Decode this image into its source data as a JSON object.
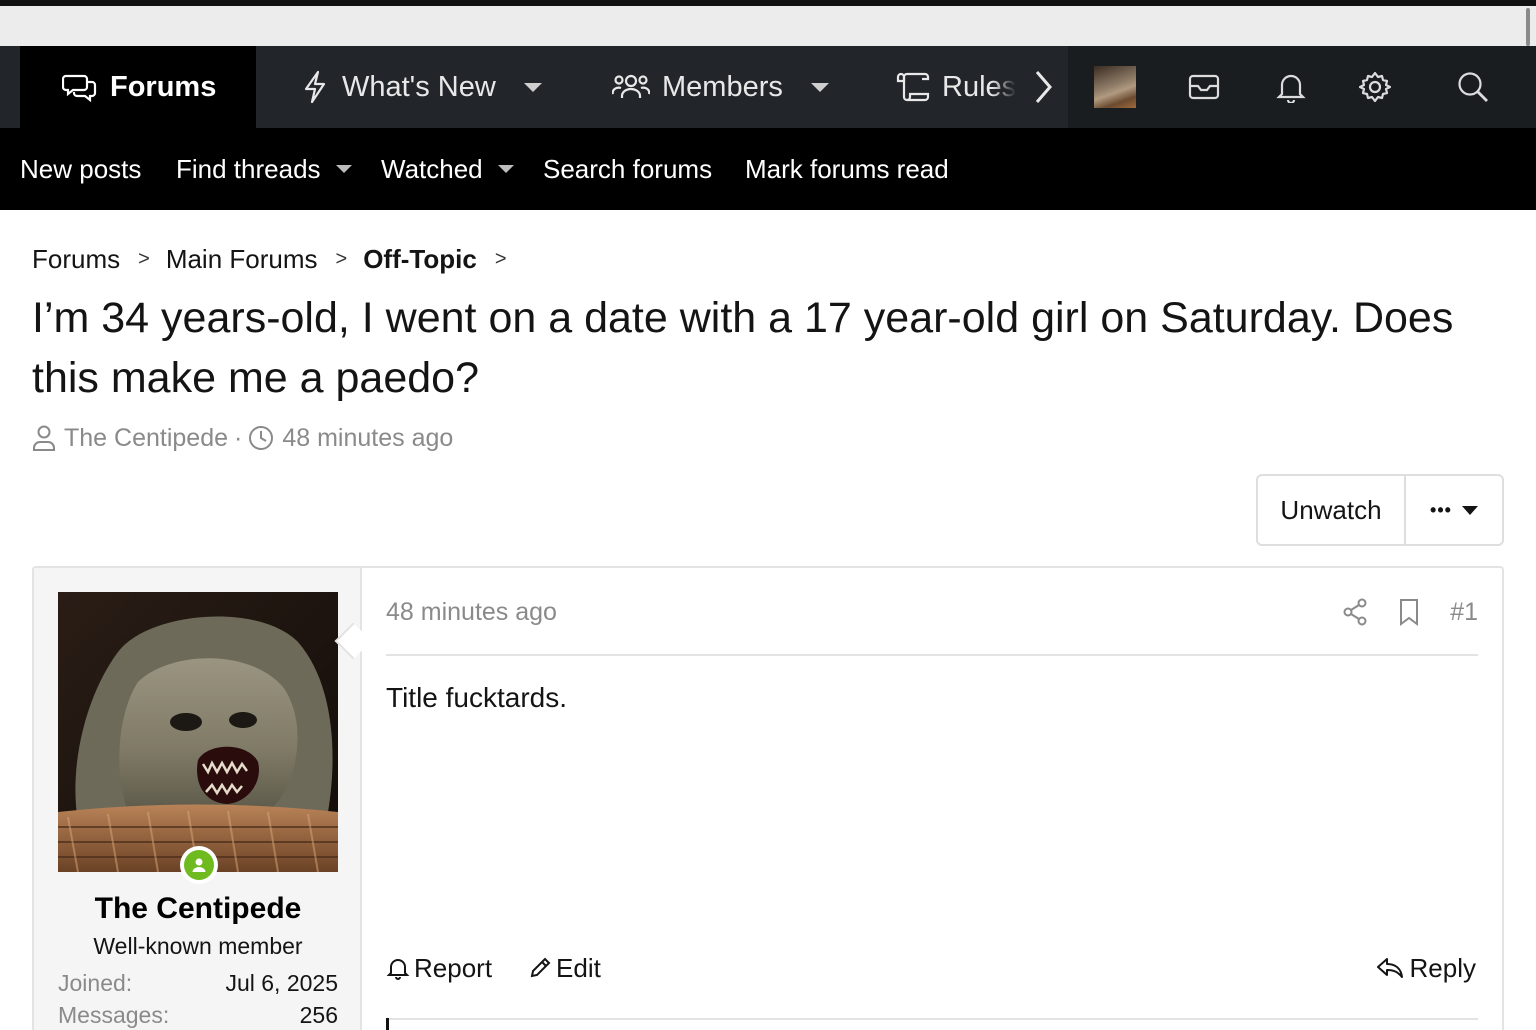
{
  "nav": {
    "tabs": [
      {
        "label": "Forums",
        "icon": "forums-icon",
        "active": true
      },
      {
        "label": "What's New",
        "icon": "lightning-icon"
      },
      {
        "label": "Members",
        "icon": "members-icon"
      },
      {
        "label": "Rules",
        "icon": "scroll-icon"
      }
    ],
    "right_icons": [
      "user-avatar-thumbnail",
      "inbox-icon",
      "bell-icon",
      "gear-icon",
      "search-icon"
    ]
  },
  "subnav": {
    "items": [
      "New posts",
      "Find threads",
      "Watched",
      "Search forums",
      "Mark forums read"
    ]
  },
  "breadcrumb": {
    "items": [
      "Forums",
      "Main Forums",
      "Off-Topic"
    ]
  },
  "thread": {
    "title": "I’m 34 years-old, I went on a date with a 17 year-old girl on Saturday. Does this make me a paedo?",
    "author": "The Centipede",
    "separator": "·",
    "time": "48 minutes ago",
    "unwatch_label": "Unwatch",
    "more_label": "•••"
  },
  "post": {
    "date": "48 minutes ago",
    "number": "#1",
    "body": "Title fucktards.",
    "actions": {
      "report": "Report",
      "edit": "Edit",
      "reply": "Reply"
    },
    "user": {
      "name": "The Centipede",
      "title": "Well-known member",
      "stats": [
        {
          "label": "Joined:",
          "value": "Jul 6, 2025"
        },
        {
          "label": "Messages:",
          "value": "256"
        }
      ],
      "online": true
    }
  },
  "colors": {
    "navbar": "#22262a",
    "subnav": "#000000",
    "online": "#6fba1e",
    "muted_text": "#8a8a8a"
  }
}
